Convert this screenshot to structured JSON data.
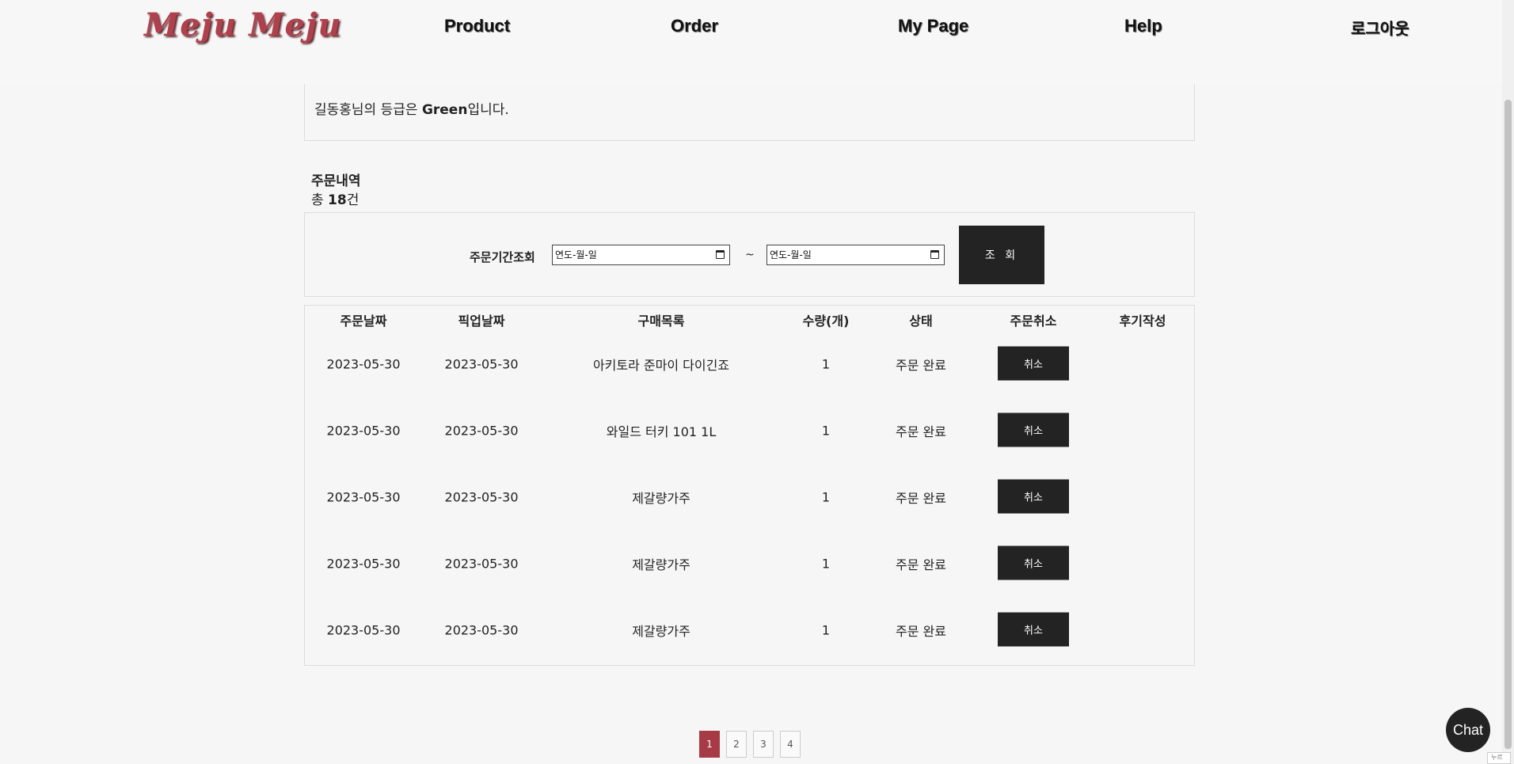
{
  "header": {
    "logo": "Meju Meju",
    "nav": {
      "product": "Product",
      "order": "Order",
      "mypage": "My Page",
      "help": "Help",
      "logout": "로그아웃"
    }
  },
  "grade": {
    "prefix": "길동홍님의 등급은 ",
    "level": "Green",
    "suffix": "입니다."
  },
  "history": {
    "title": "주문내역",
    "total_prefix": "총 ",
    "total_count": "18",
    "total_suffix": "건"
  },
  "period": {
    "label": "주문기간조회",
    "start_placeholder": "연도-월-일",
    "end_placeholder": "연도-월-일",
    "separator": "~",
    "search_button": "조 회"
  },
  "table": {
    "headers": {
      "order_date": "주문날짜",
      "pickup_date": "픽업날짜",
      "items": "구매목록",
      "quantity": "수량(개)",
      "status": "상태",
      "cancel": "주문취소",
      "review": "후기작성"
    },
    "rows": [
      {
        "order_date": "2023-05-30",
        "pickup_date": "2023-05-30",
        "item": "아키토라 준마이 다이긴죠",
        "qty": "1",
        "status": "주문 완료",
        "cancel_label": "취소"
      },
      {
        "order_date": "2023-05-30",
        "pickup_date": "2023-05-30",
        "item": "와일드 터키 101 1L",
        "qty": "1",
        "status": "주문 완료",
        "cancel_label": "취소"
      },
      {
        "order_date": "2023-05-30",
        "pickup_date": "2023-05-30",
        "item": "제갈량가주",
        "qty": "1",
        "status": "주문 완료",
        "cancel_label": "취소"
      },
      {
        "order_date": "2023-05-30",
        "pickup_date": "2023-05-30",
        "item": "제갈량가주",
        "qty": "1",
        "status": "주문 완료",
        "cancel_label": "취소"
      },
      {
        "order_date": "2023-05-30",
        "pickup_date": "2023-05-30",
        "item": "제갈량가주",
        "qty": "1",
        "status": "주문 완료",
        "cancel_label": "취소"
      }
    ]
  },
  "pagination": {
    "pages": [
      "1",
      "2",
      "3",
      "4"
    ],
    "current": "1"
  },
  "chat": {
    "label": "Chat"
  },
  "corner_tab": {
    "label": "누르"
  },
  "colors": {
    "accent": "#a63a45",
    "button_dark": "#232323",
    "background": "#f6f6f6"
  }
}
